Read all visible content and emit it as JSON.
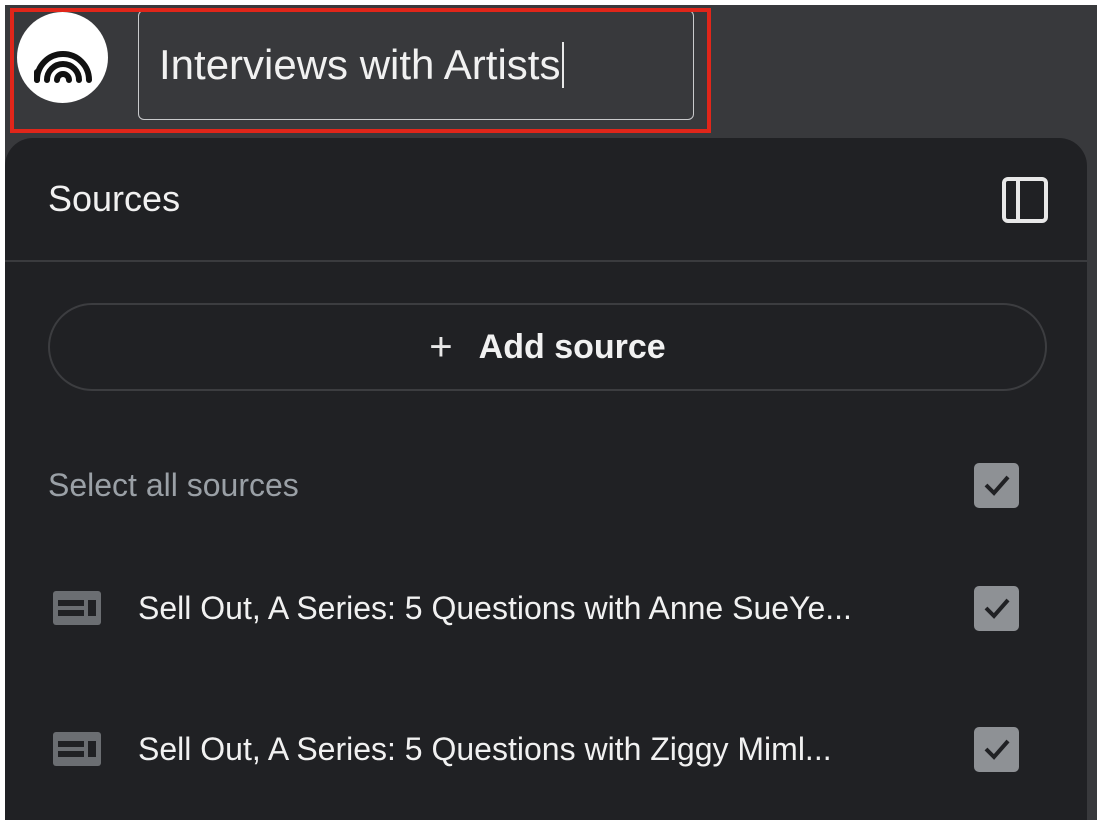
{
  "header": {
    "logo_icon": "notebook-logo-icon",
    "title_value": "Interviews with Artists"
  },
  "panel": {
    "title": "Sources",
    "collapse_icon": "panel-toggle-icon",
    "add_source_label": "Add source",
    "select_all_label": "Select all sources",
    "select_all_checked": true,
    "sources": [
      {
        "label": "Sell Out, A Series: 5 Questions with Anne SueYe...",
        "icon": "webpage-icon",
        "checked": true
      },
      {
        "label": "Sell Out, A Series: 5 Questions with Ziggy Miml...",
        "icon": "webpage-icon",
        "checked": true
      }
    ]
  },
  "colors": {
    "highlight": "#e0261a",
    "panel_bg": "#202124",
    "app_bg": "#38393c"
  }
}
